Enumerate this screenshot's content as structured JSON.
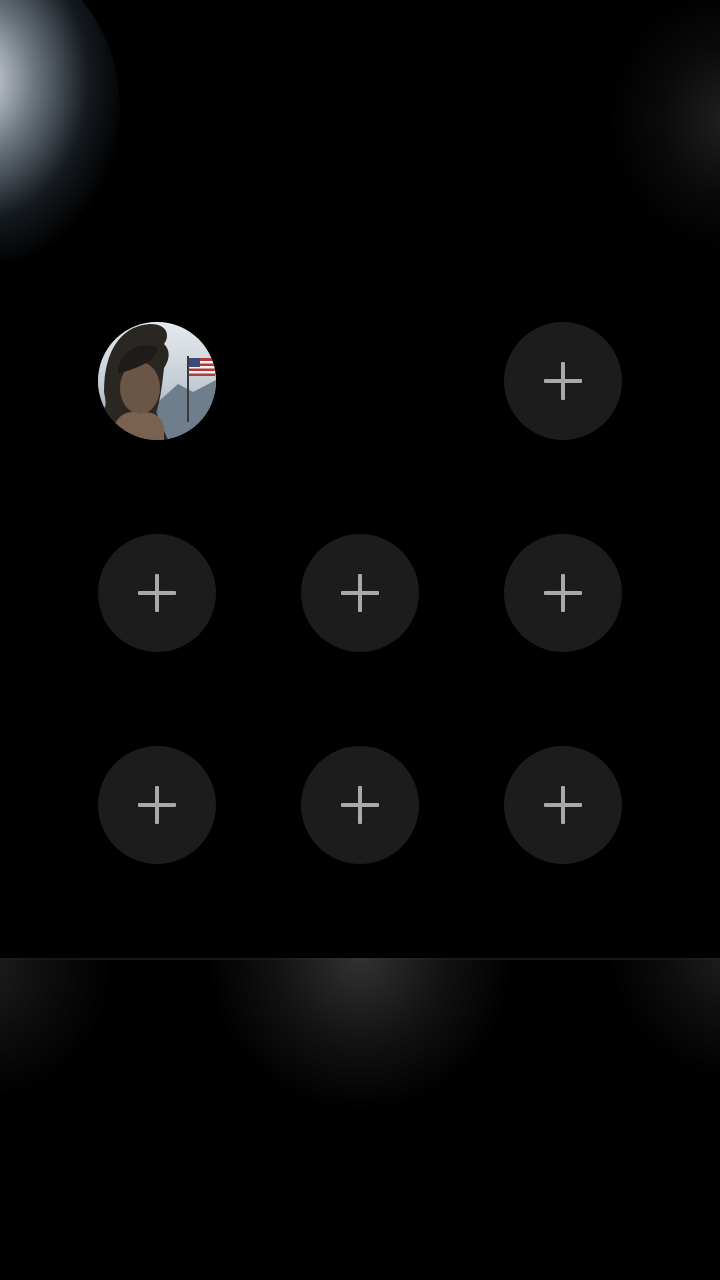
{
  "colors": {
    "background": "#000000",
    "slot_fill": "#1c1c1c",
    "plus_glyph": "#a9a9a9"
  },
  "grid": {
    "rows": [
      [
        {
          "type": "avatar",
          "name": "profile-photo"
        },
        {
          "type": "empty"
        },
        {
          "type": "add",
          "icon": "plus-icon"
        }
      ],
      [
        {
          "type": "add",
          "icon": "plus-icon"
        },
        {
          "type": "add",
          "icon": "plus-icon"
        },
        {
          "type": "add",
          "icon": "plus-icon"
        }
      ],
      [
        {
          "type": "add",
          "icon": "plus-icon"
        },
        {
          "type": "add",
          "icon": "plus-icon"
        },
        {
          "type": "add",
          "icon": "plus-icon"
        }
      ]
    ]
  }
}
